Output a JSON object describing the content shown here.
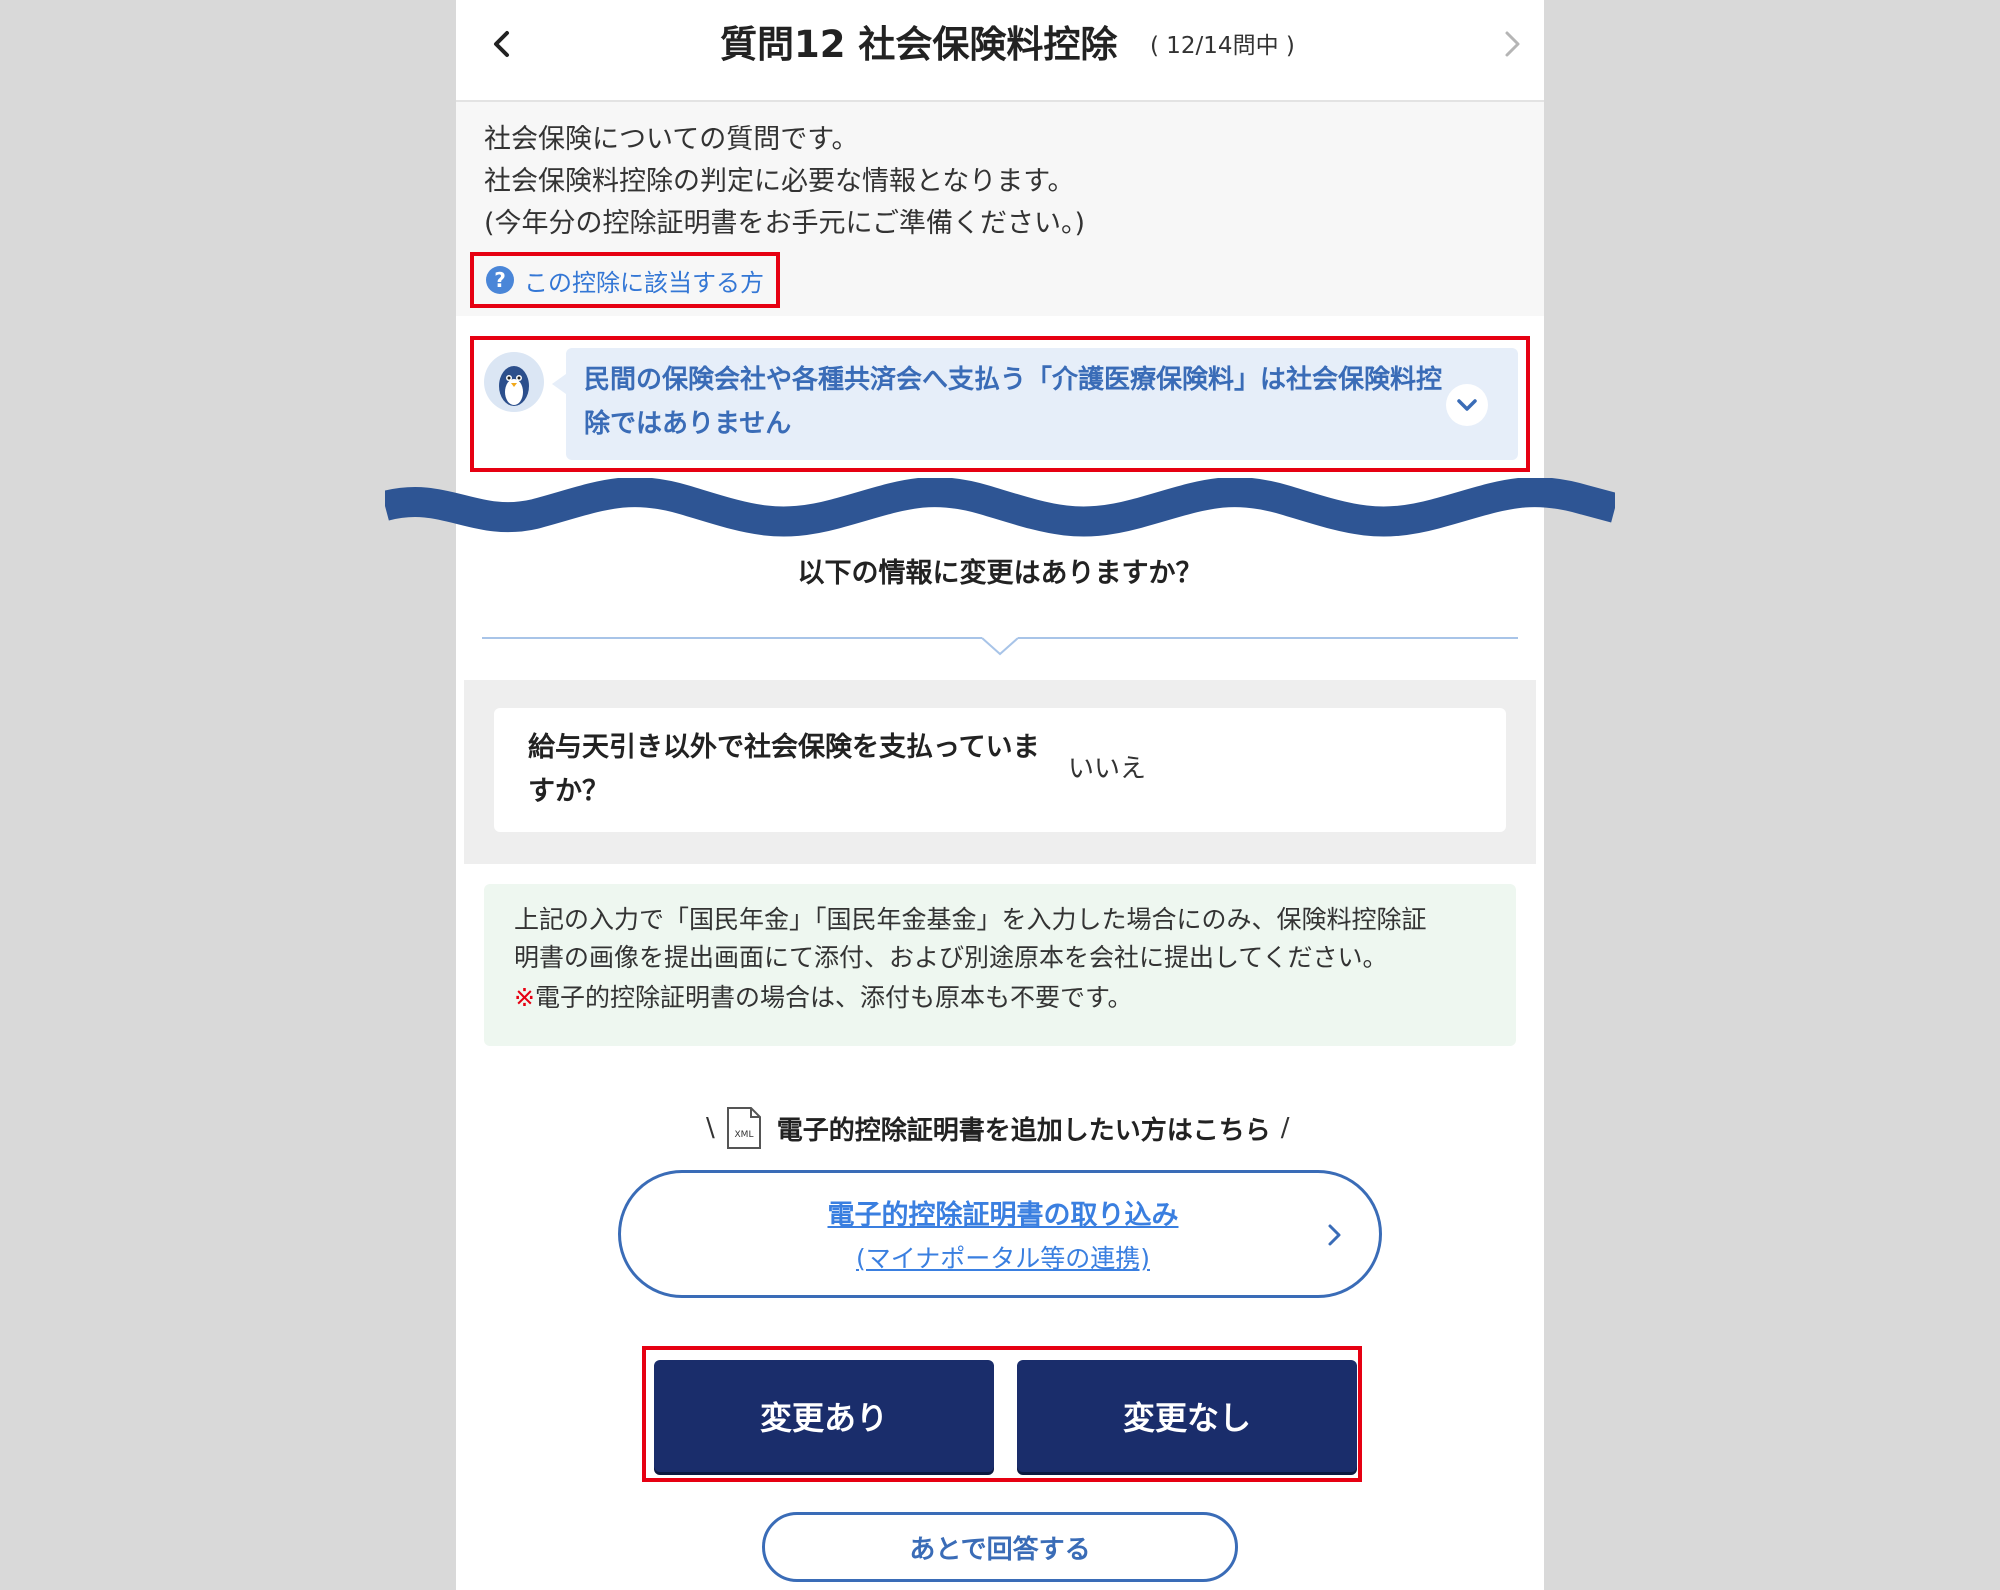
{
  "header": {
    "title": "質問12 社会保険料控除",
    "count": "( 12/14問中 )"
  },
  "intro": {
    "lines": [
      "社会保険についての質問です。",
      "社会保険料控除の判定に必要な情報となります。",
      "(今年分の控除証明書をお手元にご準備ください。)"
    ],
    "help_icon": "?",
    "help_link": "この控除に該当する方"
  },
  "notice": {
    "text": "民間の保険会社や各種共済会へ支払う「介護医療保険料」は社会保険料控除ではありません"
  },
  "question": "以下の情報に変更はありますか？",
  "summary": {
    "question": "給与天引き以外で社会保険を支払っていますか？",
    "answer": "いいえ"
  },
  "info": {
    "line1": "上記の入力で「国民年金」「国民年金基金」を入力した場合にのみ、保険料控除証",
    "line2": "明書の画像を提出画面にて添付、および別途原本を会社に提出してください。",
    "mark": "※",
    "line3": "電子的控除証明書の場合は、添付も原本も不要です。"
  },
  "xml_section": {
    "slash_left": "\\",
    "slash_right": "/",
    "icon_label": "XML",
    "heading": "電子的控除証明書を追加したい方はこちら",
    "button_main": "電子的控除証明書の取り込み",
    "button_sub": "(マイナポータル等の連携)"
  },
  "actions": {
    "changed": "変更あり",
    "unchanged": "変更なし",
    "later": "あとで回答する"
  },
  "colors": {
    "highlight": "#e60012",
    "primary_dark": "#1a2d6b",
    "link": "#3477d5"
  }
}
